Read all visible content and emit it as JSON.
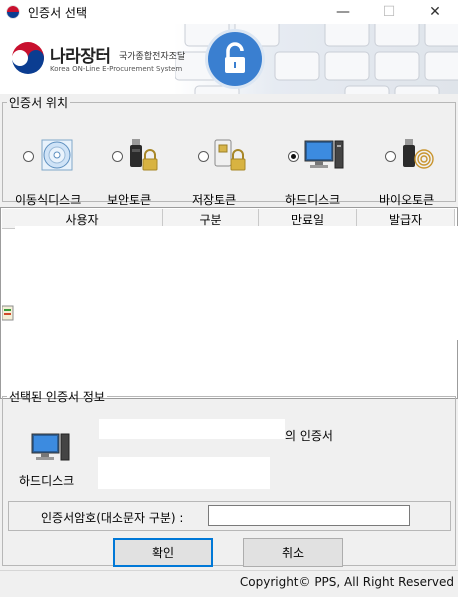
{
  "window": {
    "title": "인증서 선택",
    "minimize_symbol": "—",
    "maximize_symbol": "☐",
    "close_symbol": "✕"
  },
  "banner": {
    "logo_main": "나라장터",
    "logo_sub": "국가종합전자조달",
    "logo_english": "Korea ON-Line E-Procurement System",
    "accent_color": "#3a7fd0"
  },
  "location_group": {
    "legend": "인증서 위치",
    "options": [
      {
        "label": "이동식디스크",
        "icon": "cd-disc-icon",
        "selected": false
      },
      {
        "label": "보안토큰",
        "icon": "usb-lock-icon",
        "selected": false
      },
      {
        "label": "저장토큰",
        "icon": "card-lock-icon",
        "selected": false
      },
      {
        "label": "하드디스크",
        "icon": "computer-icon",
        "selected": true
      },
      {
        "label": "바이오토큰",
        "icon": "fingerprint-usb-icon",
        "selected": false
      }
    ]
  },
  "cert_table": {
    "columns": [
      "사용자",
      "구분",
      "만료일",
      "발급자"
    ]
  },
  "info_group": {
    "legend": "선택된 인증서 정보",
    "name_suffix": "의 인증서",
    "media_label": "하드디스크"
  },
  "password": {
    "label": "인증서암호(대소문자 구분) :",
    "value": ""
  },
  "buttons": {
    "ok": "확인",
    "cancel": "취소"
  },
  "footer": {
    "copyright": "Copyright© PPS, All Right Reserved"
  }
}
